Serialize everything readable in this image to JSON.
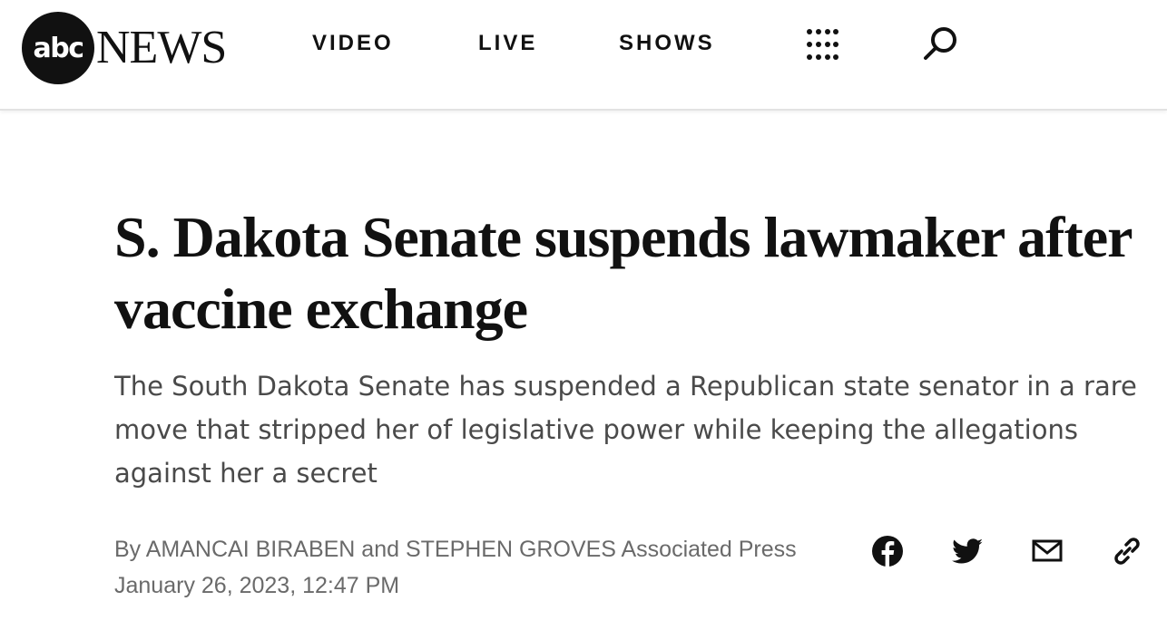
{
  "brand": {
    "logo_circle_text": "abc",
    "logo_word": "NEWS"
  },
  "nav": {
    "items": [
      "VIDEO",
      "LIVE",
      "SHOWS"
    ]
  },
  "icons": {
    "menu": "grid-menu-icon",
    "search": "search-icon",
    "share": [
      "facebook-icon",
      "twitter-icon",
      "email-icon",
      "link-icon"
    ]
  },
  "article": {
    "headline": "S. Dakota Senate suspends lawmaker after vaccine exchange",
    "subhead": "The South Dakota Senate has suspended a Republican state senator in a rare move that stripped her of legislative power while keeping the allegations against her a secret",
    "byline": "By AMANCAI BIRABEN and STEPHEN GROVES Associated Press",
    "date": "January 26, 2023, 12:47 PM"
  },
  "colors": {
    "text": "#111111",
    "subtext": "#4a4a4a",
    "meta": "#6a6a6a"
  }
}
